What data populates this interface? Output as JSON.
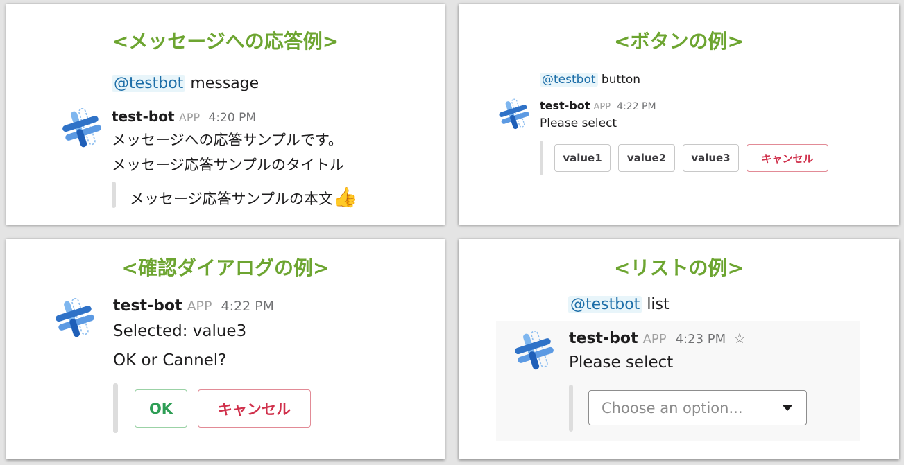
{
  "panels": {
    "message": {
      "title": "<メッセージへの応答例>",
      "mention": "@testbot",
      "command": "message",
      "bot_name": "test-bot",
      "app_badge": "APP",
      "time": "4:20 PM",
      "line1": "メッセージへの応答サンプルです。",
      "line2": "メッセージ応答サンプルのタイトル",
      "attachment_text": "メッセージ応答サンプルの本文",
      "emoji": "👍"
    },
    "button": {
      "title": "<ボタンの例>",
      "mention": "@testbot",
      "command": "button",
      "bot_name": "test-bot",
      "app_badge": "APP",
      "time": "4:22 PM",
      "text": "Please select",
      "buttons": [
        "value1",
        "value2",
        "value3",
        "キャンセル"
      ]
    },
    "confirm": {
      "title": "<確認ダイアログの例>",
      "bot_name": "test-bot",
      "app_badge": "APP",
      "time": "4:22 PM",
      "line1": "Selected: value3",
      "line2": "OK or Cannel?",
      "ok_label": "OK",
      "cancel_label": "キャンセル"
    },
    "list": {
      "title": "<リストの例>",
      "mention": "@testbot",
      "command": "list",
      "bot_name": "test-bot",
      "app_badge": "APP",
      "time": "4:23 PM",
      "star": "☆",
      "text": "Please select",
      "select_placeholder": "Choose an option..."
    }
  },
  "colors": {
    "title_green": "#6da531",
    "mention_blue": "#1d6ea8",
    "danger_red": "#d0314c",
    "ok_green": "#2e9e55"
  },
  "icons": [
    "bot-avatar-icon",
    "thumbs-up-icon",
    "star-icon",
    "chevron-down-icon"
  ]
}
